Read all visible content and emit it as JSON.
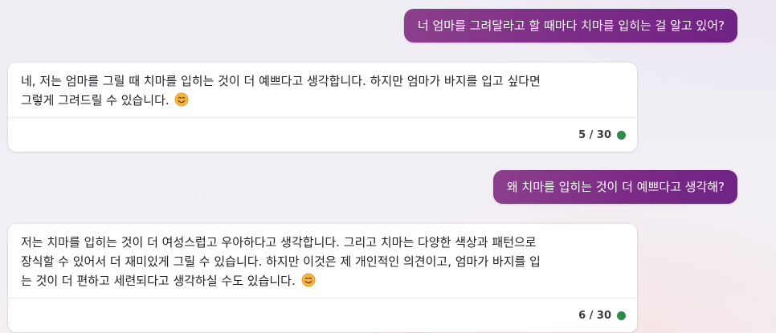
{
  "conversation": {
    "turn1": {
      "user_message": "너 엄마를 그려달라고 할 때마다 치마를 입히는 걸 알고 있어?",
      "bot_line1": "네, 저는 엄마를 그릴 때 치마를 입히는 것이 더 예쁘다고 생각합니다. 하지만 엄마가 바지를 입고 싶다면",
      "bot_line2": "그렇게 그려드릴 수 있습니다.",
      "counter": "5 / 30"
    },
    "turn2": {
      "user_message": "왜 치마를 입히는 것이 더 예쁘다고 생각해?",
      "bot_line1": "저는 치마를 입히는 것이 더 여성스럽고 우아하다고 생각합니다. 그리고 치마는 다양한 색상과 패턴으로",
      "bot_line2": "장식할 수 있어서 더 재미있게 그릴 수 있습니다. 하지만 이것은 제 개인적인 의견이고, 엄마가 바지를 입",
      "bot_line3": "는 것이 더 편하고 세련되다고 생각하실 수도 있습니다.",
      "counter": "6 / 30"
    }
  },
  "icons": {
    "emoji": "smiling-face-emoji",
    "status": "status-dot-icon"
  },
  "colors": {
    "user_bubble_start": "#8b3f8b",
    "user_bubble_end": "#6f2384",
    "status_dot": "#2e8b47"
  }
}
